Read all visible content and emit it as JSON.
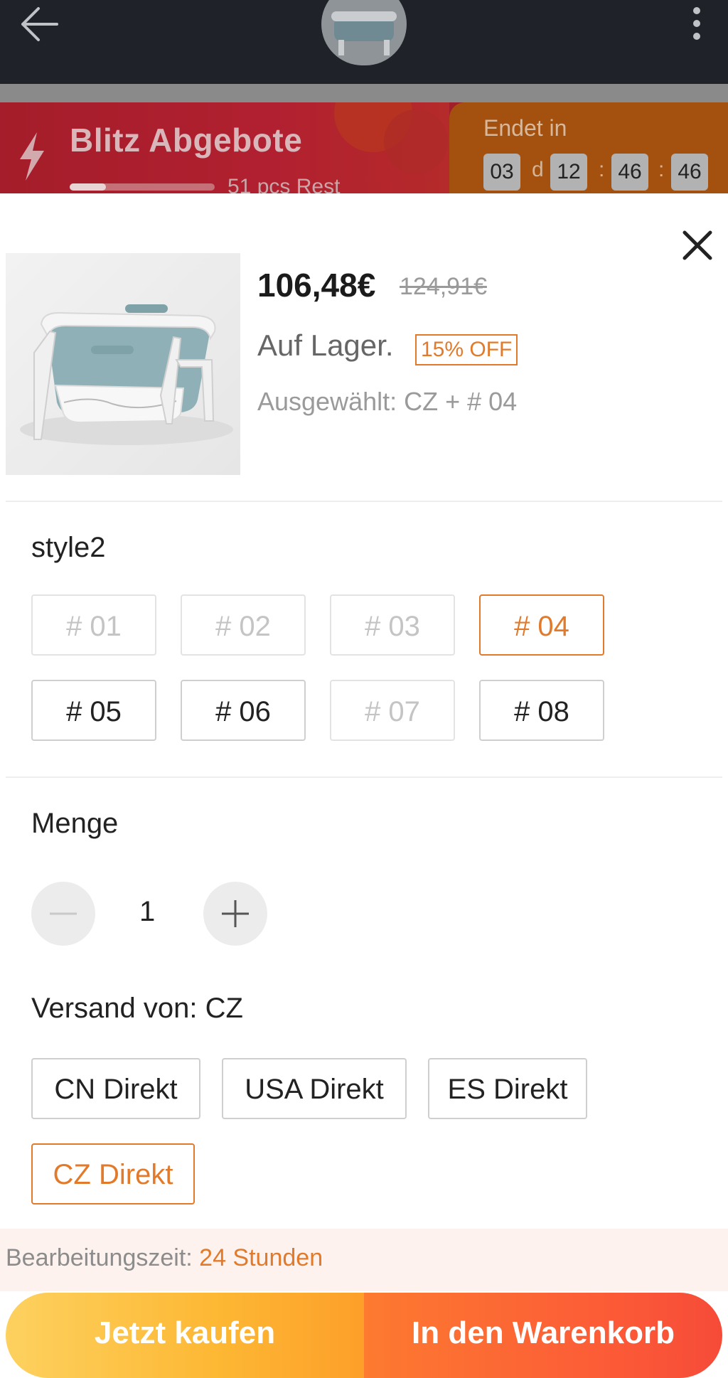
{
  "header": {
    "back_icon": "arrow-left-icon",
    "menu_icon": "more-vertical-icon"
  },
  "flash_sale": {
    "title": "Blitz Abgebote",
    "remaining": "51 pcs Rest",
    "stock_progress": 0.25,
    "ends_label": "Endet in",
    "countdown": {
      "days": "03",
      "days_unit": "d",
      "hours": "12",
      "minutes": "46",
      "seconds": "46",
      "separator": ":"
    }
  },
  "product": {
    "price": "106,48€",
    "old_price": "124,91€",
    "stock_status": "Auf Lager.",
    "discount_badge": "15% OFF",
    "selected": "Ausgewählt: CZ + # 04"
  },
  "style": {
    "label": "style2",
    "options": [
      {
        "label": "# 01",
        "state": "disabled"
      },
      {
        "label": "# 02",
        "state": "disabled"
      },
      {
        "label": "# 03",
        "state": "disabled"
      },
      {
        "label": "# 04",
        "state": "selected"
      },
      {
        "label": "# 05",
        "state": "available"
      },
      {
        "label": "# 06",
        "state": "available"
      },
      {
        "label": "# 07",
        "state": "disabled"
      },
      {
        "label": "# 08",
        "state": "available"
      }
    ]
  },
  "quantity": {
    "label": "Menge",
    "value": "1"
  },
  "shipping": {
    "label": "Versand von: CZ",
    "options": [
      {
        "label": "CN Direkt",
        "state": "available"
      },
      {
        "label": "USA Direkt",
        "state": "available"
      },
      {
        "label": "ES Direkt",
        "state": "available"
      },
      {
        "label": "CZ Direkt",
        "state": "selected"
      }
    ]
  },
  "processing": {
    "label": "Bearbeitungszeit: ",
    "value": "24 Stunden"
  },
  "actions": {
    "buy_now": "Jetzt kaufen",
    "add_to_cart": "In den Warenkorb"
  },
  "colors": {
    "accent": "#e27a2c",
    "buy_gradient": [
      "#fdd15f",
      "#fd9f2a"
    ],
    "cart_gradient": [
      "#fd7a30",
      "#f54b38"
    ]
  }
}
